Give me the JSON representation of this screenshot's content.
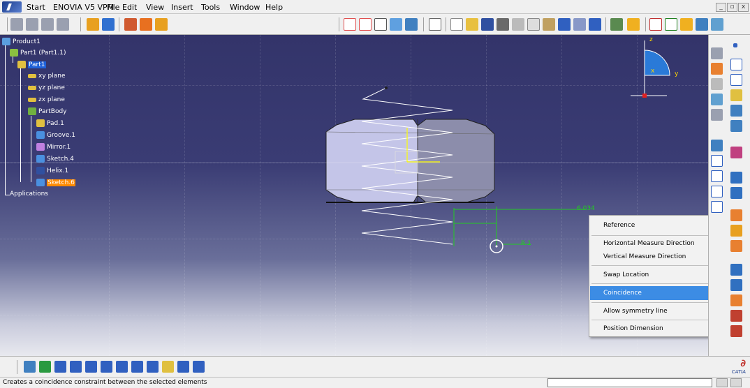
{
  "menubar": {
    "items": [
      "Start",
      "ENOVIA V5 VPM",
      "File",
      "Edit",
      "View",
      "Insert",
      "Tools",
      "Window",
      "Help"
    ],
    "window_controls": [
      "_",
      "▫",
      "x"
    ]
  },
  "tree": {
    "product": "Product1",
    "part_instance": "Part1 (Part1.1)",
    "part": "Part1",
    "xy": "xy plane",
    "yz": "yz plane",
    "zx": "zx plane",
    "partbody": "PartBody",
    "pad": "Pad.1",
    "groove": "Groove.1",
    "mirror": "Mirror.1",
    "sketch4": "Sketch.4",
    "helix": "Helix.1",
    "sketch6": "Sketch.6",
    "applications": "Applications"
  },
  "viewport": {
    "dimension_value": "6.034",
    "radius_label": "R 1",
    "compass": {
      "z": "z",
      "y": "y",
      "x": "x"
    }
  },
  "context_menu": {
    "items": [
      {
        "label": "Reference",
        "highlighted": false
      },
      {
        "label": "Horizontal Measure Direction",
        "highlighted": false
      },
      {
        "label": "Vertical Measure Direction",
        "highlighted": false
      },
      {
        "label": "Swap Location",
        "highlighted": false
      },
      {
        "label": "Coincidence",
        "highlighted": true
      },
      {
        "label": "Allow symmetry line",
        "highlighted": false
      },
      {
        "label": "Position Dimension",
        "highlighted": false
      }
    ]
  },
  "status": {
    "message": "Creates a coincidence constraint between the selected elements"
  },
  "brand": {
    "logo_text": "CATIA"
  },
  "colors": {
    "viewport_top": "#33346a",
    "selection_blue": "#1e60d8",
    "selection_orange": "#ff8a00",
    "menu_highlight": "#3c8ce4",
    "constraint_green": "#22cc22"
  }
}
